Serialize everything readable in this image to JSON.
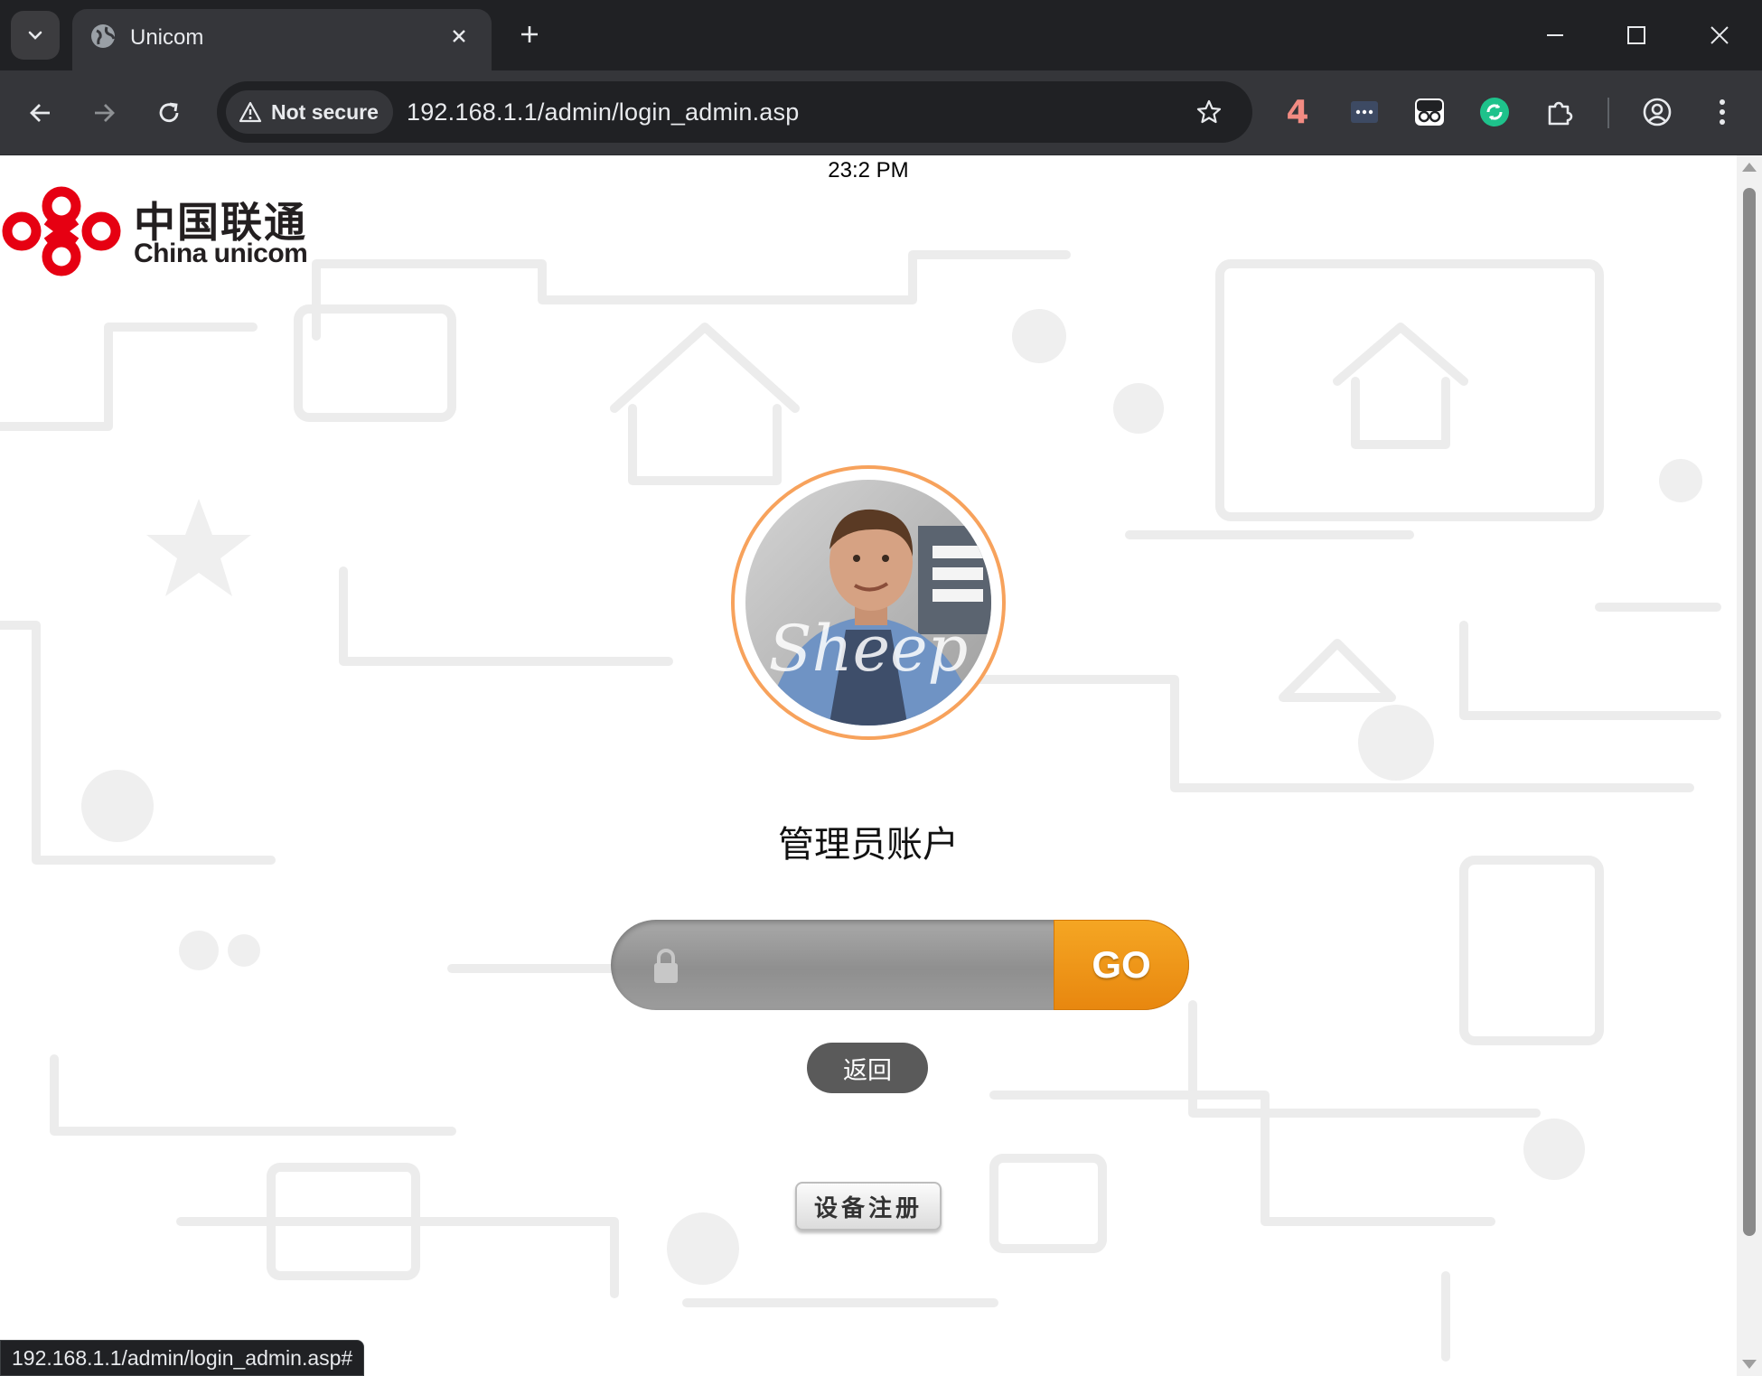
{
  "browser": {
    "tab_title": "Unicom",
    "security_label": "Not secure",
    "url": "192.168.1.1/admin/login_admin.asp",
    "extension_badge": "4",
    "status_url": "192.168.1.1/admin/login_admin.asp#"
  },
  "page": {
    "clock": "23:2 PM",
    "logo": {
      "chinese": "中国联通",
      "english": "China unicom"
    },
    "avatar_watermark": "Sheep",
    "account_title": "管理员账户",
    "password": {
      "value": "",
      "placeholder": ""
    },
    "go_label": "GO",
    "back_label": "返回",
    "register_label": "设备注册"
  },
  "colors": {
    "go_orange": "#ee8d14",
    "brand_red": "#e60012",
    "avatar_ring": "#f7a25c"
  }
}
